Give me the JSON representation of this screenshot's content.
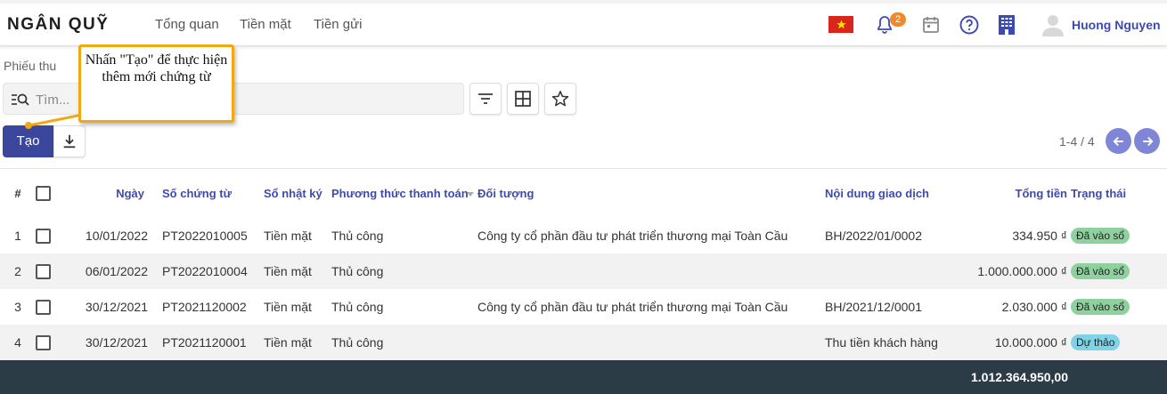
{
  "app": {
    "title": "NGÂN QUỸ",
    "nav": [
      "Tổng quan",
      "Tiền mặt",
      "Tiền gửi"
    ],
    "notification_count": "2",
    "user_name": "Huong Nguyen"
  },
  "breadcrumb": "Phiếu thu",
  "search": {
    "placeholder": "Tìm...",
    "value": ""
  },
  "toolbar": {
    "create_label": "Tạo"
  },
  "pager": {
    "text": "1-4 / 4"
  },
  "callout": {
    "text": "Nhấn \"Tạo\" để thực hiện thêm mới chứng từ"
  },
  "table": {
    "headers": [
      "#",
      "Ngày",
      "Số chứng từ",
      "Sổ nhật ký",
      "Phương thức thanh toán",
      "Đối tượng",
      "Nội dung giao dịch",
      "Tổng tiền",
      "Trạng thái"
    ],
    "rows": [
      {
        "no": "1",
        "date": "10/01/2022",
        "code": "PT2022010005",
        "journal": "Tiền mặt",
        "method": "Thủ công",
        "partner": "Công ty cổ phần đầu tư phát triển thương mại Toàn Cầu",
        "memo": "BH/2022/01/0002",
        "total": "334.950 ₫",
        "status": "Đã vào sổ",
        "status_color": "#8fd19e"
      },
      {
        "no": "2",
        "date": "06/01/2022",
        "code": "PT2022010004",
        "journal": "Tiền mặt",
        "method": "Thủ công",
        "partner": "",
        "memo": "",
        "total": "1.000.000.000 ₫",
        "status": "Đã vào sổ",
        "status_color": "#8fd19e"
      },
      {
        "no": "3",
        "date": "30/12/2021",
        "code": "PT2021120002",
        "journal": "Tiền mặt",
        "method": "Thủ công",
        "partner": "Công ty cổ phần đầu tư phát triển thương mại Toàn Cầu",
        "memo": "BH/2021/12/0001",
        "total": "2.030.000 ₫",
        "status": "Đã vào sổ",
        "status_color": "#8fd19e"
      },
      {
        "no": "4",
        "date": "30/12/2021",
        "code": "PT2021120001",
        "journal": "Tiền mặt",
        "method": "Thủ công",
        "partner": "",
        "memo": "Thu tiền khách hàng",
        "total": "10.000.000 ₫",
        "status": "Dự thảo",
        "status_color": "#7fd3e6"
      }
    ],
    "footer_total": "1.012.364.950,00"
  },
  "colors": {
    "primary": "#3a479c",
    "accent": "#f3a712",
    "footer": "#2c3c46"
  }
}
